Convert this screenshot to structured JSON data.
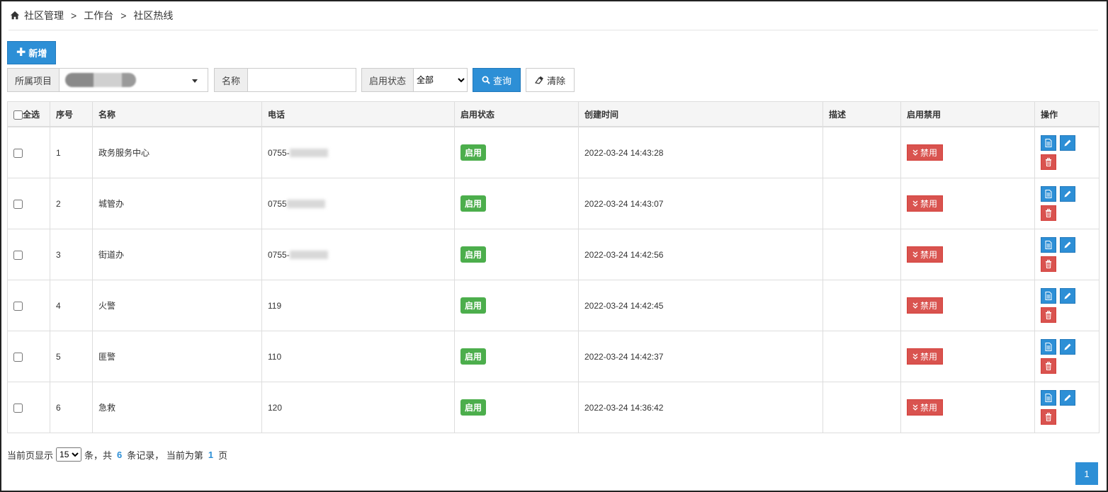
{
  "breadcrumb": {
    "items": [
      "社区管理",
      "工作台",
      "社区热线"
    ],
    "separator": ">"
  },
  "toolbar": {
    "add_label": "新增"
  },
  "filters": {
    "project_label": "所属项目",
    "name_label": "名称",
    "name_value": "",
    "status_label": "启用状态",
    "status_selected": "全部",
    "query_label": "查询",
    "clear_label": "清除"
  },
  "table": {
    "headers": {
      "select_all": "全选",
      "index": "序号",
      "name": "名称",
      "phone": "电话",
      "status": "启用状态",
      "created": "创建时间",
      "desc": "描述",
      "toggle": "启用禁用",
      "ops": "操作"
    },
    "rows": [
      {
        "index": "1",
        "name": "政务服务中心",
        "phone": "0755-",
        "status": "启用",
        "created": "2022-03-24 14:43:28",
        "desc": "",
        "toggle": "禁用"
      },
      {
        "index": "2",
        "name": "城管办",
        "phone": "0755",
        "status": "启用",
        "created": "2022-03-24 14:43:07",
        "desc": "",
        "toggle": "禁用"
      },
      {
        "index": "3",
        "name": "街道办",
        "phone": "0755-",
        "status": "启用",
        "created": "2022-03-24 14:42:56",
        "desc": "",
        "toggle": "禁用"
      },
      {
        "index": "4",
        "name": "火警",
        "phone": "119",
        "status": "启用",
        "created": "2022-03-24 14:42:45",
        "desc": "",
        "toggle": "禁用"
      },
      {
        "index": "5",
        "name": "匪警",
        "phone": "110",
        "status": "启用",
        "created": "2022-03-24 14:42:37",
        "desc": "",
        "toggle": "禁用"
      },
      {
        "index": "6",
        "name": "急救",
        "phone": "120",
        "status": "启用",
        "created": "2022-03-24 14:36:42",
        "desc": "",
        "toggle": "禁用"
      }
    ]
  },
  "footer": {
    "prefix": "当前页显示",
    "page_size": "15",
    "mid1": "条，共",
    "total": "6",
    "mid2": "条记录， 当前为第",
    "current_page": "1",
    "suffix": "页"
  },
  "pagination": {
    "page": "1"
  },
  "colors": {
    "primary": "#2d8fd6",
    "success": "#4cae4c",
    "danger": "#d9534f"
  }
}
